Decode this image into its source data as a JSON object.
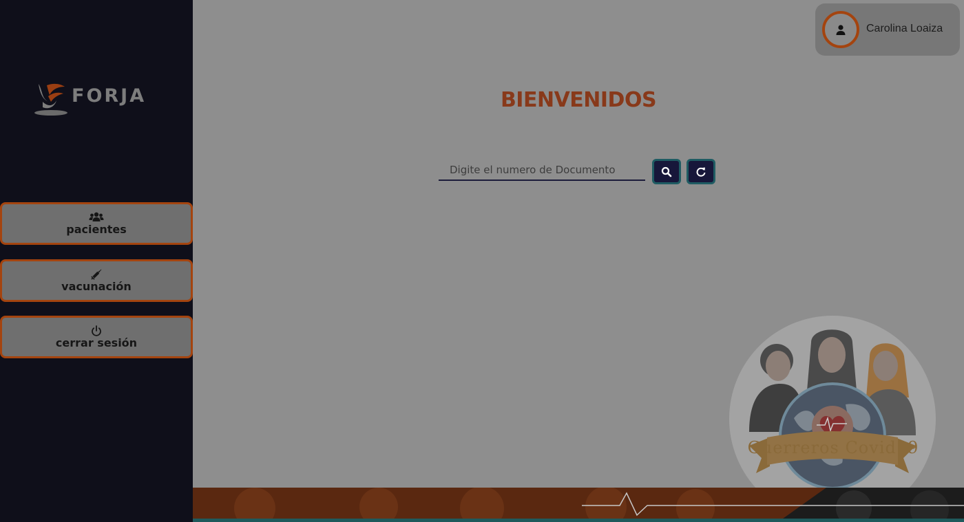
{
  "app": {
    "brand": "FORJA"
  },
  "user": {
    "name": "Carolina Loaiza",
    "icon": "user-icon"
  },
  "sidebar": {
    "items": [
      {
        "label": "pacientes",
        "icon": "users-icon"
      },
      {
        "label": "vacunación",
        "icon": "syringe-icon"
      },
      {
        "label": "cerrar sesión",
        "icon": "power-icon"
      }
    ]
  },
  "main": {
    "title": "BIENVENIDOS",
    "search": {
      "placeholder": "Digite el numero de Documento",
      "value": ""
    },
    "buttons": {
      "search_icon": "search-icon",
      "refresh_icon": "refresh-icon"
    },
    "illustration": {
      "banner_text": "Guerreros Covid19"
    }
  },
  "colors": {
    "accent": "#a4440f",
    "sidebar_bg": "#0f0f1a",
    "title": "#88391a",
    "button_bg": "#17173a",
    "button_border": "#1f5c63"
  }
}
